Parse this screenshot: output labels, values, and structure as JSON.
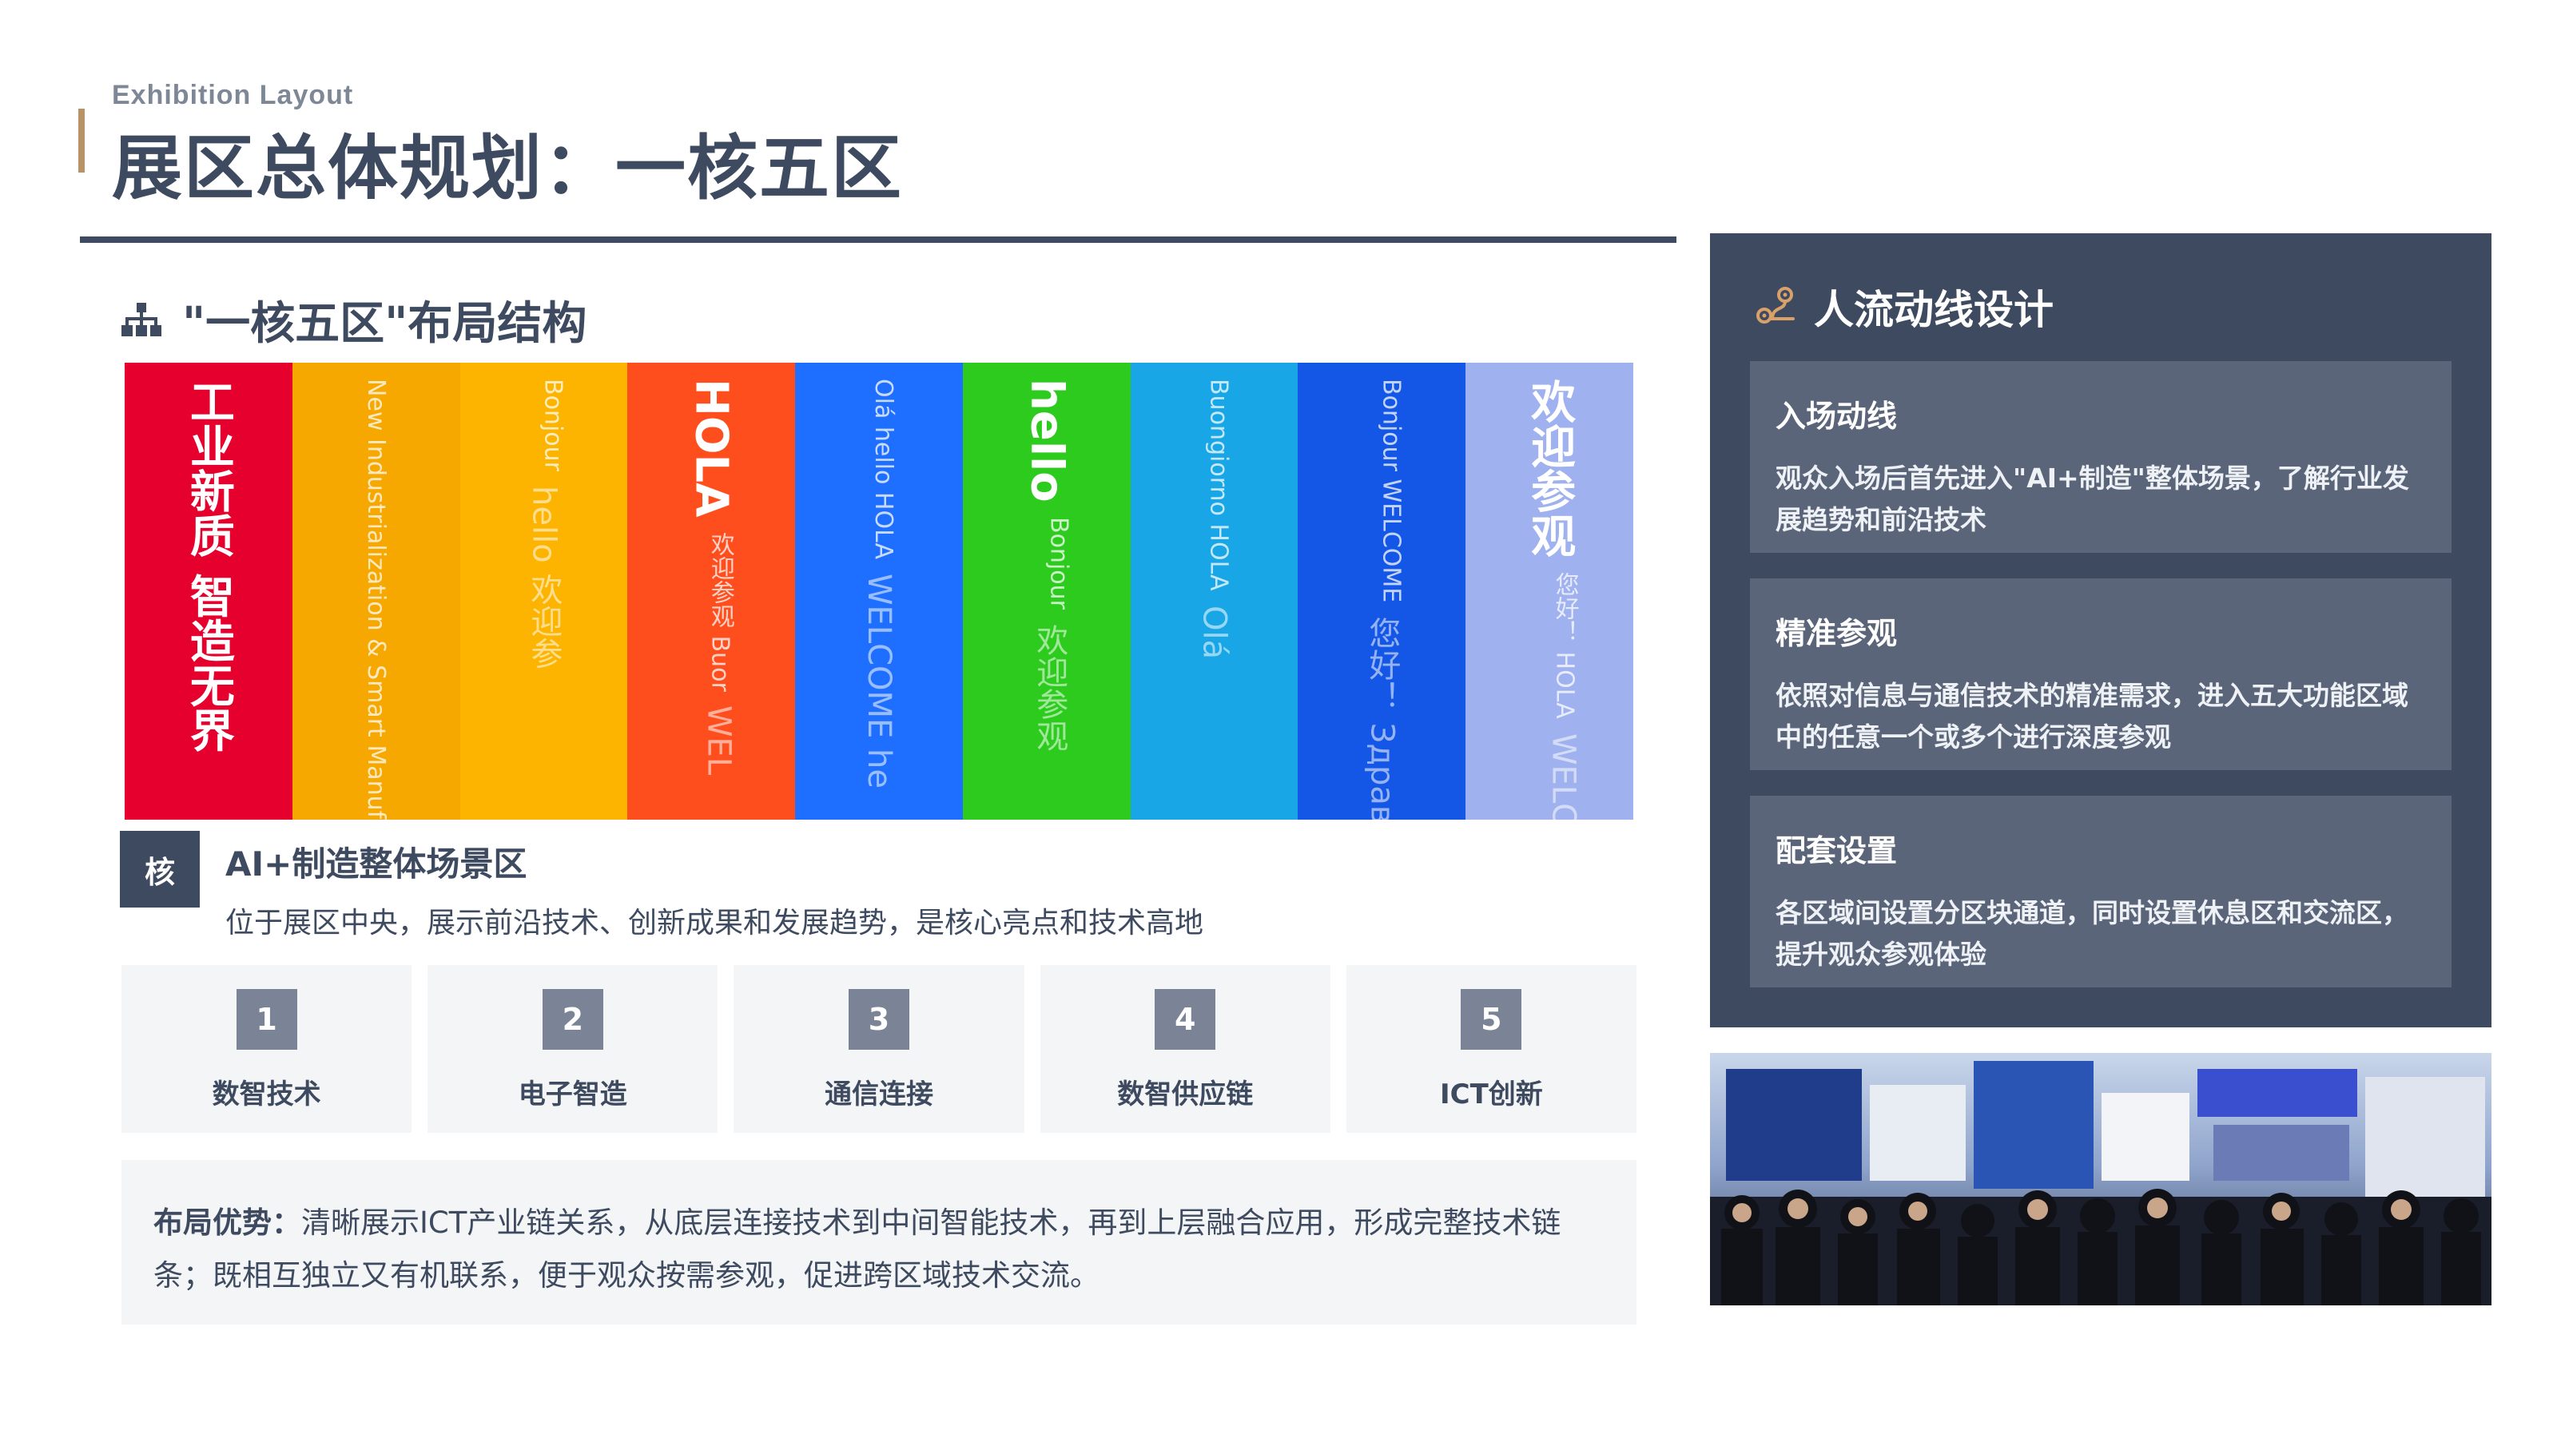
{
  "header": {
    "subtitle": "Exhibition Layout",
    "title": "展区总体规划：一核五区"
  },
  "structure": {
    "heading": "\"一核五区\"布局结构",
    "icon": "sitemap-icon",
    "banner_strips": [
      {
        "color": "#e6002d",
        "main": "工业新质 智造无界",
        "aux": "",
        "aux2": ""
      },
      {
        "color": "#f6a800",
        "main": "",
        "aux": "New Industrialization & Smart Manufacturing Resilience",
        "aux2": ""
      },
      {
        "color": "#fdb400",
        "main": "",
        "aux": "Bonjour",
        "aux2": "hello 欢迎参"
      },
      {
        "color": "#ff4e1e",
        "main": "HOLA",
        "aux": "欢迎参观 Buor",
        "aux2": "WEL"
      },
      {
        "color": "#1e6fff",
        "main": "",
        "aux": "Olá hello HOLA",
        "aux2": "WELCOME he"
      },
      {
        "color": "#2ccb1e",
        "main": "hello",
        "aux": "Bonjour",
        "aux2": "欢迎参观"
      },
      {
        "color": "#18a6e6",
        "main": "",
        "aux": "Buongiorno HOLA",
        "aux2": "Olá"
      },
      {
        "color": "#1456e6",
        "main": "",
        "aux": "Bonjour WELCOME",
        "aux2": "您好！ Здравствуй"
      },
      {
        "color": "#9fb1ef",
        "main": "欢迎参观",
        "aux": "您好！ HOLA",
        "aux2": "WELCOME hello"
      }
    ]
  },
  "core": {
    "badge": "核",
    "title": "AI+制造整体场景区",
    "desc": "位于展区中央，展示前沿技术、创新成果和发展趋势，是核心亮点和技术高地"
  },
  "zones": [
    {
      "num": "1",
      "name": "数智技术"
    },
    {
      "num": "2",
      "name": "电子智造"
    },
    {
      "num": "3",
      "name": "通信连接"
    },
    {
      "num": "4",
      "name": "数智供应链"
    },
    {
      "num": "5",
      "name": "ICT创新"
    }
  ],
  "advantage": {
    "label": "布局优势：",
    "text": "清晰展示ICT产业链关系，从底层连接技术到中间智能技术，再到上层融合应用，形成完整技术链条；既相互独立又有机联系，便于观众按需参观，促进跨区域技术交流。"
  },
  "flow": {
    "heading": "人流动线设计",
    "icon": "route-icon",
    "cards": [
      {
        "title": "入场动线",
        "text": "观众入场后首先进入\"AI+制造\"整体场景，了解行业发展趋势和前沿技术"
      },
      {
        "title": "精准参观",
        "text": "依照对信息与通信技术的精准需求，进入五大功能区域中的任意一个或多个进行深度参观"
      },
      {
        "title": "配套设置",
        "text": "各区域间设置分区块通道，同时设置休息区和交流区，提升观众参观体验"
      }
    ]
  },
  "colors": {
    "primary": "#3d4a5f",
    "accent": "#b89366",
    "card_bg": "#f4f5f7",
    "zone_num_bg": "#7b8496",
    "panel_card": "#5a6579"
  }
}
